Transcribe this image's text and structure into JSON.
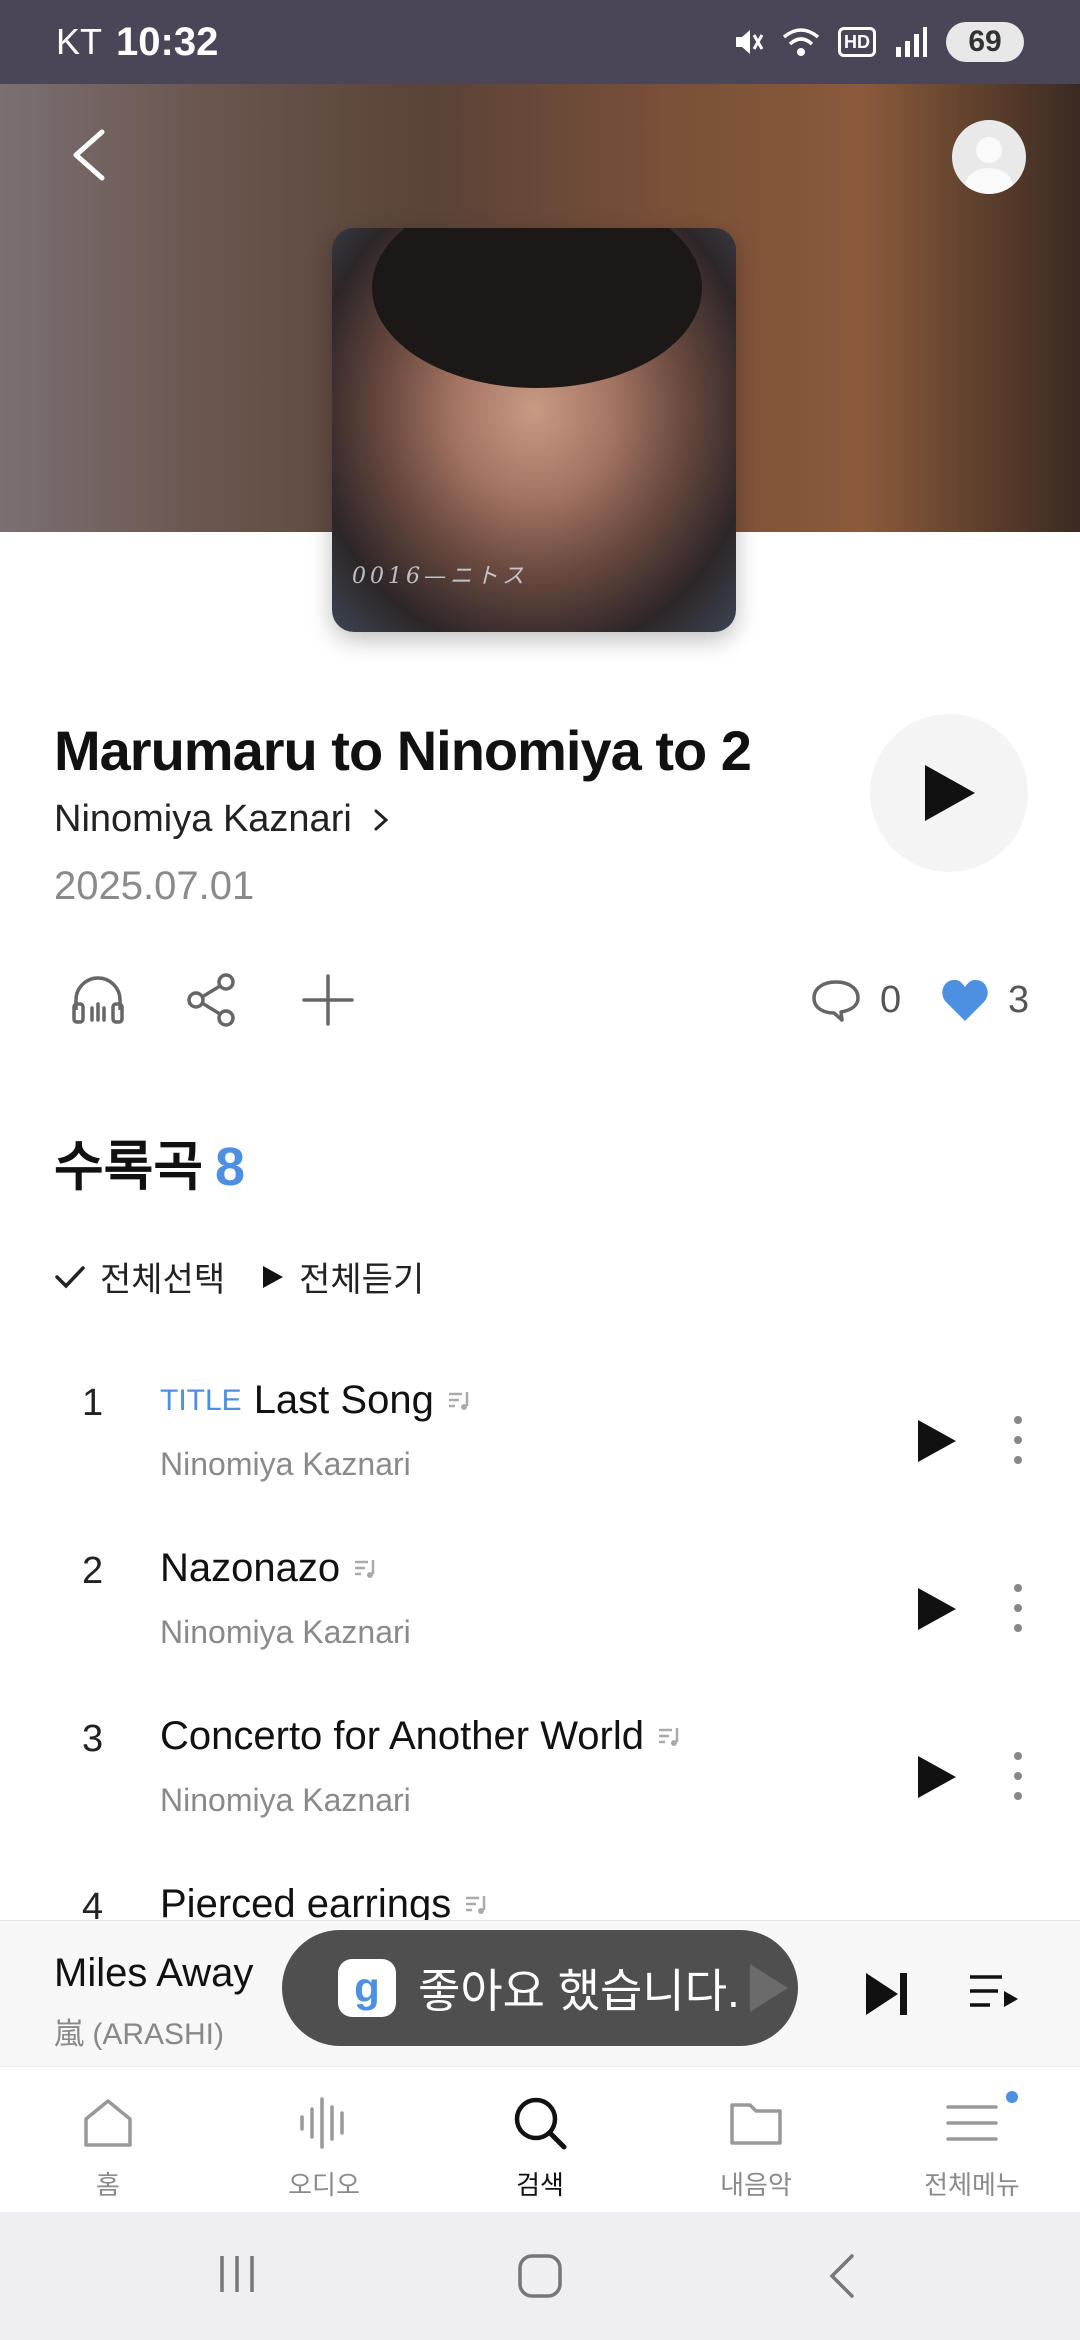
{
  "status_bar": {
    "carrier": "KT",
    "time": "10:32",
    "battery": "69"
  },
  "album": {
    "title": "Marumaru to Ninomiya to 2",
    "artist": "Ninomiya Kaznari",
    "release_date": "2025.07.01",
    "comment_count": "0",
    "like_count": "3",
    "art_signature": "0016—ニトス"
  },
  "tracks_section": {
    "heading": "수록곡",
    "count": "8",
    "select_all": "전체선택",
    "play_all": "전체듣기"
  },
  "tracks": [
    {
      "number": "1",
      "badge": "TITLE",
      "title": "Last Song",
      "artist": "Ninomiya Kaznari"
    },
    {
      "number": "2",
      "badge": "",
      "title": "Nazonazo",
      "artist": "Ninomiya Kaznari"
    },
    {
      "number": "3",
      "badge": "",
      "title": "Concerto for Another World",
      "artist": "Ninomiya Kaznari"
    },
    {
      "number": "4",
      "badge": "",
      "title": "Pierced earrings",
      "artist": ""
    }
  ],
  "now_playing": {
    "title": "Miles Away",
    "artist": "嵐 (ARASHI)"
  },
  "toast": {
    "logo": "g",
    "message": "좋아요 했습니다."
  },
  "bottom_nav": [
    {
      "label": "홈",
      "icon": "home-icon"
    },
    {
      "label": "오디오",
      "icon": "audio-wave-icon"
    },
    {
      "label": "검색",
      "icon": "search-icon"
    },
    {
      "label": "내음악",
      "icon": "folder-icon"
    },
    {
      "label": "전체메뉴",
      "icon": "menu-icon"
    }
  ],
  "colors": {
    "accent": "#4d8fe0",
    "status_bar": "#4a4658",
    "like": "#4d8fe0"
  }
}
